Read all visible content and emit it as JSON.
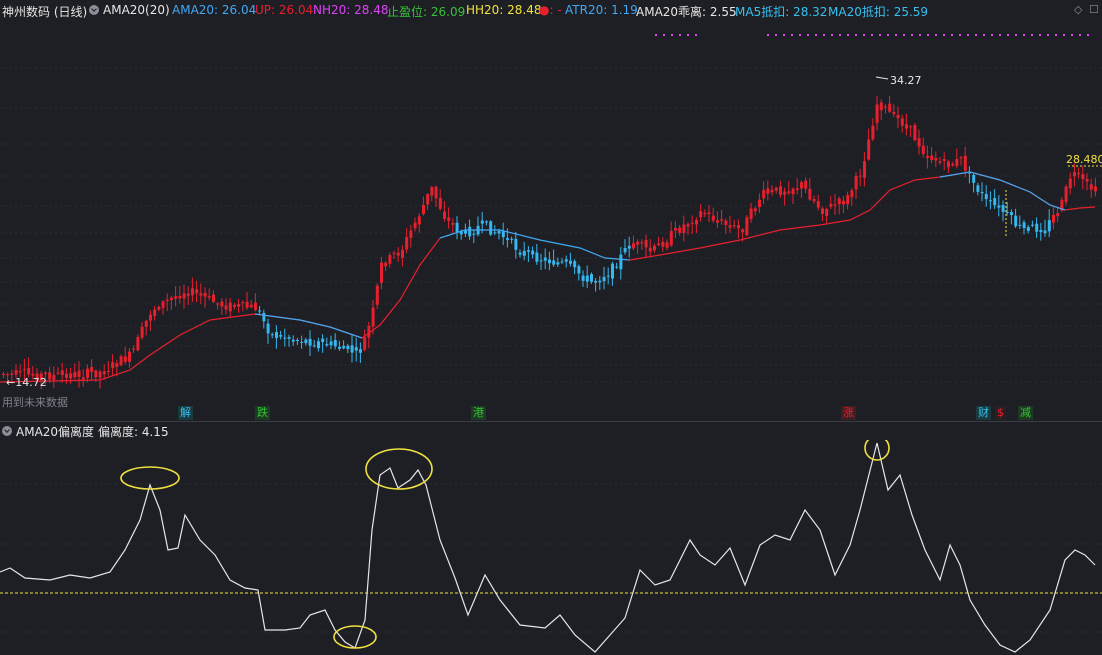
{
  "header": {
    "stock_name": "神州数码 (日线)",
    "indicator": "AMA20(20)",
    "items": [
      {
        "label": "AMA20: 26.04",
        "color": "#3fa9f5"
      },
      {
        "label": "UP: 26.04",
        "color": "#e8202e"
      },
      {
        "label": "NH20: 28.48",
        "color": "#e040fb"
      },
      {
        "label": "止盈位: 26.09",
        "color": "#36c236"
      },
      {
        "label": "HH20: 28.48",
        "color": "#f0e040"
      },
      {
        "label": "●: -",
        "color": "#e8202e"
      },
      {
        "label": "ATR20: 1.19",
        "color": "#3fa9f5"
      },
      {
        "label": "AMA20乖离: 2.55",
        "color": "#e6e6e6"
      },
      {
        "label": "MA5抵扣: 28.32",
        "color": "#35c0f0"
      },
      {
        "label": "MA20抵扣: 25.59",
        "color": "#35c0f0"
      }
    ]
  },
  "main_chart": {
    "high_label": "34.27",
    "low_label": "←14.72",
    "last_label": "28.480",
    "future_note": "用到未来数据",
    "events": [
      {
        "label": "解",
        "color": "#35c0f0",
        "bg": "#1c3a3d"
      },
      {
        "label": "跌",
        "color": "#36c236",
        "bg": "#1d3a24"
      },
      {
        "label": "港",
        "color": "#36c236",
        "bg": "#1d3a24"
      },
      {
        "label": "涨",
        "color": "#e8202e",
        "bg": "#3d1f22"
      },
      {
        "label": "财",
        "color": "#35c0f0",
        "bg": "#1c3a3d"
      },
      {
        "label": "$",
        "color": "#e8202e",
        "bg": "#2a2024"
      },
      {
        "label": "减",
        "color": "#36c236",
        "bg": "#1d3a24"
      }
    ]
  },
  "sub_chart": {
    "title": "AMA20偏离度",
    "value_label": "偏离度: 4.15"
  },
  "colors": {
    "up": "#e8202e",
    "down": "#35b7f0",
    "ama_up": "#e8202e",
    "ama_down": "#3fa9f5",
    "deviation": "#e6e6e6",
    "zero_line": "#f0e040",
    "highlight": "#f0e040"
  }
}
